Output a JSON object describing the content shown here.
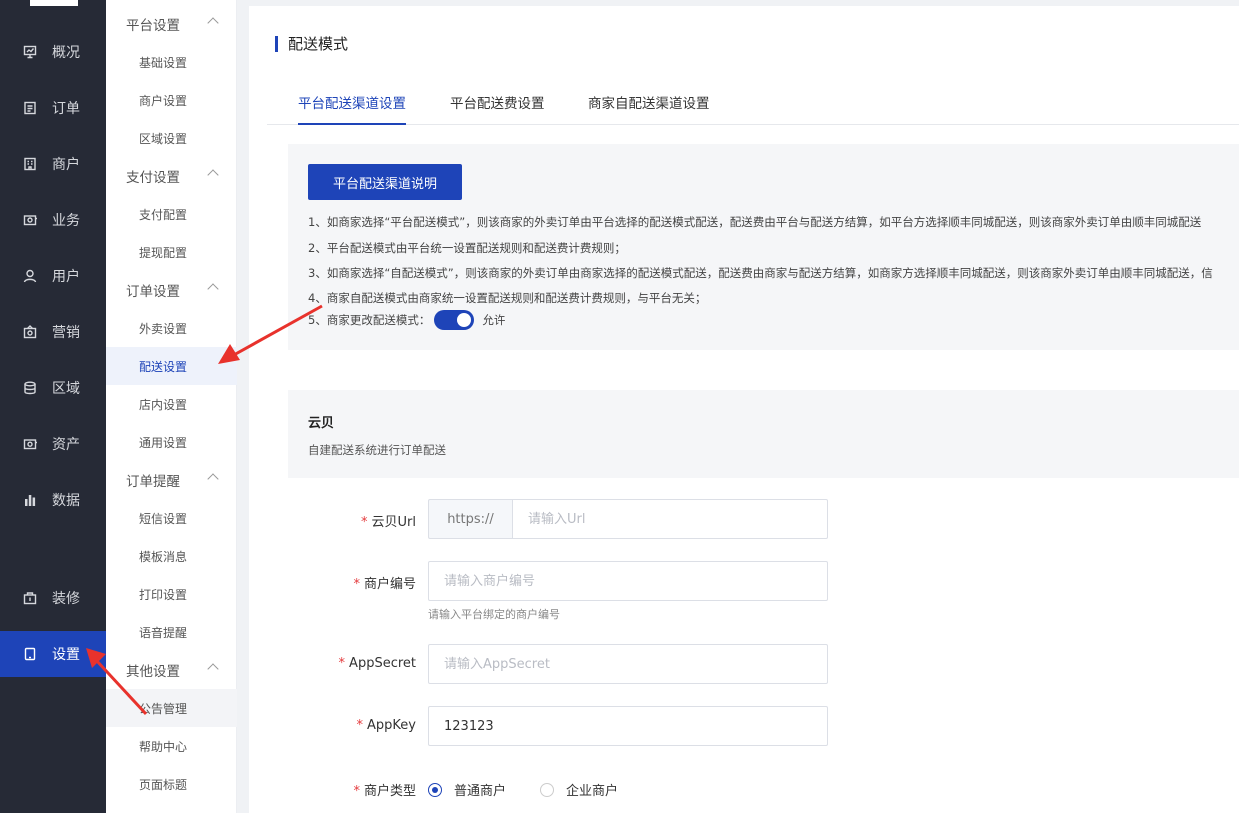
{
  "nav": {
    "items": [
      {
        "label": "概况",
        "icon": "chart-icon"
      },
      {
        "label": "订单",
        "icon": "document-icon"
      },
      {
        "label": "商户",
        "icon": "building-icon"
      },
      {
        "label": "业务",
        "icon": "briefcase-icon"
      },
      {
        "label": "用户",
        "icon": "user-icon"
      },
      {
        "label": "营销",
        "icon": "gift-icon"
      },
      {
        "label": "区域",
        "icon": "database-icon"
      },
      {
        "label": "资产",
        "icon": "wallet-icon"
      },
      {
        "label": "数据",
        "icon": "bar-chart-icon"
      },
      {
        "label": "装修",
        "icon": "bag-icon"
      },
      {
        "label": "设置",
        "icon": "tablet-icon"
      }
    ]
  },
  "submenu": {
    "groups": [
      {
        "title": "平台设置",
        "items": [
          "基础设置",
          "商户设置",
          "区域设置"
        ]
      },
      {
        "title": "支付设置",
        "items": [
          "支付配置",
          "提现配置"
        ]
      },
      {
        "title": "订单设置",
        "items": [
          "外卖设置",
          "配送设置",
          "店内设置",
          "通用设置"
        ]
      },
      {
        "title": "订单提醒",
        "items": [
          "短信设置",
          "模板消息",
          "打印设置",
          "语音提醒"
        ]
      },
      {
        "title": "其他设置",
        "items": [
          "公告管理",
          "帮助中心",
          "页面标题"
        ]
      }
    ],
    "active": "配送设置"
  },
  "page": {
    "title": "配送模式",
    "tabs": [
      "平台配送渠道设置",
      "平台配送费设置",
      "商家自配送渠道设置"
    ],
    "active_tab": "平台配送渠道设置"
  },
  "info": {
    "button": "平台配送渠道说明",
    "lines": [
      "1、如商家选择“平台配送模式”，则该商家的外卖订单由平台选择的配送模式配送，配送费由平台与配送方结算，如平台方选择顺丰同城配送，则该商家外卖订单由顺丰同城配送",
      "2、平台配送模式由平台统一设置配送规则和配送费计费规则；",
      "3、如商家选择“自配送模式”，则该商家的外卖订单由商家选择的配送模式配送，配送费由商家与配送方结算，如商家方选择顺丰同城配送，则该商家外卖订单由顺丰同城配送，信",
      "4、商家自配送模式由商家统一设置配送规则和配送费计费规则，与平台无关；"
    ],
    "line5_label": "5、商家更改配送模式：",
    "toggle_text": "允许"
  },
  "section": {
    "title": "云贝",
    "desc": "自建配送系统进行订单配送"
  },
  "form": {
    "url_label": "云贝Url",
    "url_prefix": "https://",
    "url_placeholder": "请输入Url",
    "merchant_no_label": "商户编号",
    "merchant_no_placeholder": "请输入商户编号",
    "merchant_no_help": "请输入平台绑定的商户编号",
    "secret_label": "AppSecret",
    "secret_placeholder": "请输入AppSecret",
    "appkey_label": "AppKey",
    "appkey_value": "123123",
    "type_label": "商户类型",
    "type_options": [
      "普通商户",
      "企业商户"
    ],
    "type_selected": "普通商户"
  },
  "colors": {
    "primary": "#1e44b8",
    "nav_bg": "#262a36",
    "annotation": "#e8322c"
  }
}
